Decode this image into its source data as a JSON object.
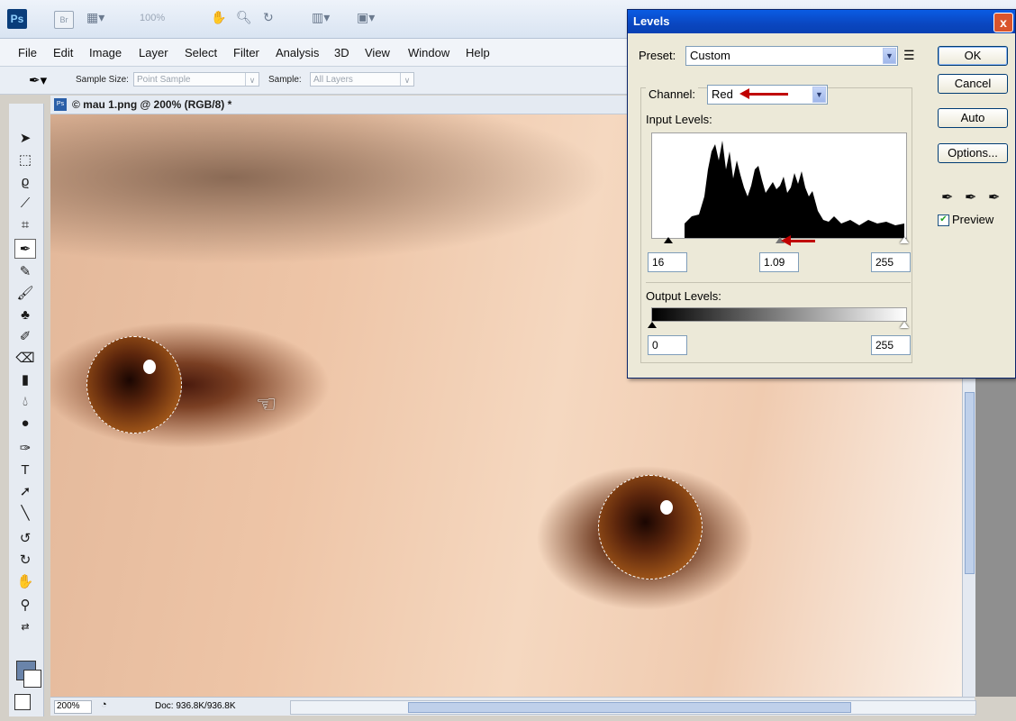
{
  "app": {
    "logo": "Ps",
    "bridge_logo": "Br",
    "zoom_display": "100%",
    "menu": [
      "File",
      "Edit",
      "Image",
      "Layer",
      "Select",
      "Filter",
      "Analysis",
      "3D",
      "View",
      "Window",
      "Help"
    ]
  },
  "options_bar": {
    "sample_size_label": "Sample Size:",
    "sample_size_value": "Point Sample",
    "sample_label": "Sample:",
    "sample_value": "All Layers"
  },
  "document": {
    "tab_title": "© mau 1.png @ 200% (RGB/8) *"
  },
  "status": {
    "zoom": "200%",
    "doc_size": "Doc: 936.8K/936.8K"
  },
  "levels_dialog": {
    "title": "Levels",
    "close": "x",
    "preset_label": "Preset:",
    "preset_value": "Custom",
    "channel_label": "Channel:",
    "channel_value": "Red",
    "input_levels_label": "Input Levels:",
    "input_black": "16",
    "input_gamma": "1.09",
    "input_white": "255",
    "output_levels_label": "Output Levels:",
    "output_black": "0",
    "output_white": "255",
    "ok": "OK",
    "cancel": "Cancel",
    "auto": "Auto",
    "options": "Options...",
    "preview_label": "Preview",
    "preview_checked": true
  },
  "icons": {
    "accent": "#0a46c0",
    "annotation_arrow": "#c00000"
  }
}
